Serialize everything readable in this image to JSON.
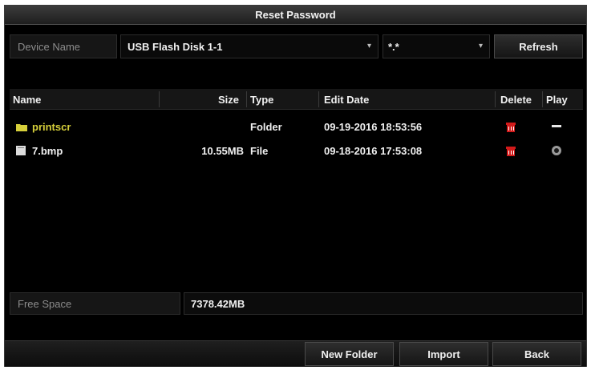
{
  "dialog": {
    "title": "Reset Password"
  },
  "device": {
    "label": "Device Name",
    "selected": "USB Flash Disk 1-1",
    "filter": "*.*",
    "refresh_label": "Refresh"
  },
  "file_list": {
    "columns": {
      "name": "Name",
      "size": "Size",
      "type": "Type",
      "edit_date": "Edit Date",
      "delete": "Delete",
      "play": "Play"
    },
    "rows": [
      {
        "name": "printscr",
        "size": "",
        "type": "Folder",
        "edit_date": "09-19-2016 18:53:56",
        "icon": "folder-icon",
        "play_icon": "dash-icon"
      },
      {
        "name": "7.bmp",
        "size": "10.55MB",
        "type": "File",
        "edit_date": "09-18-2016 17:53:08",
        "icon": "file-icon",
        "play_icon": "play-icon"
      }
    ]
  },
  "free_space": {
    "label": "Free Space",
    "value": "7378.42MB"
  },
  "buttons": {
    "new_folder": "New Folder",
    "import": "Import",
    "back": "Back"
  },
  "colors": {
    "folder_name": "#d6cf3a",
    "delete_icon": "#d21a1a"
  }
}
